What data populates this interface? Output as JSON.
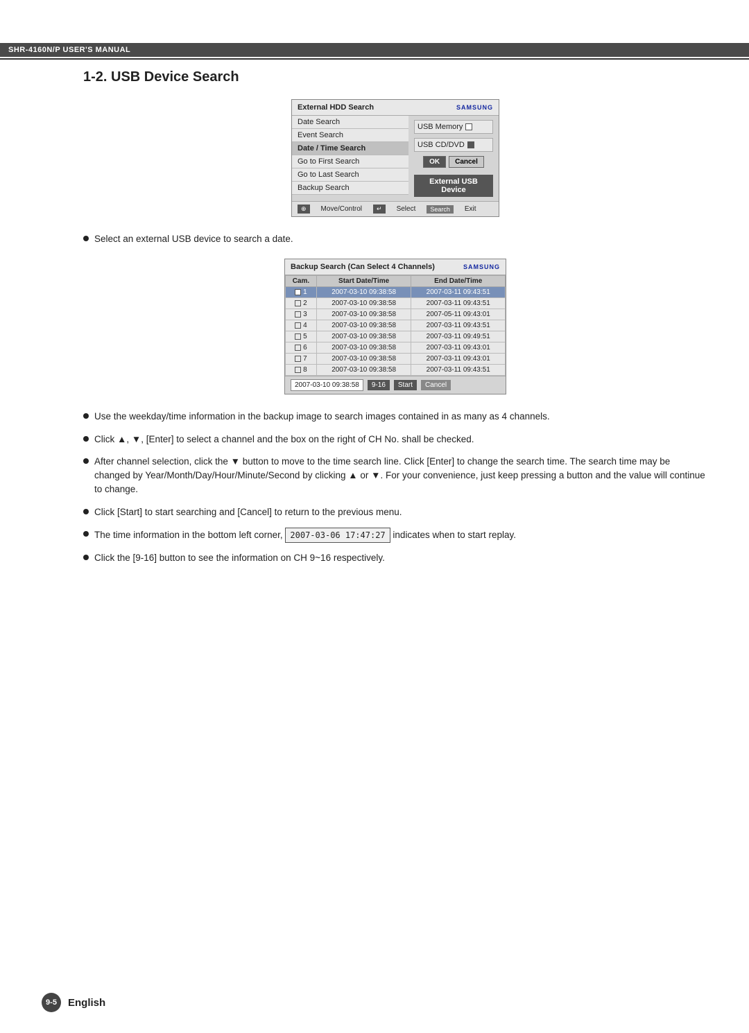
{
  "header": {
    "title": "SHR-4160N/P USER'S MANUAL"
  },
  "section": {
    "title": "1-2. USB Device Search"
  },
  "dialog1": {
    "title": "External HDD Search",
    "logo": "SAMSUNG",
    "menu_items": [
      {
        "label": "Date Search",
        "selected": false
      },
      {
        "label": "Event Search",
        "selected": false
      },
      {
        "label": "Date / Time Search",
        "selected": false
      },
      {
        "label": "Go to First Search",
        "selected": false
      },
      {
        "label": "Go to Last Search",
        "selected": false
      },
      {
        "label": "Backup Search",
        "selected": false
      }
    ],
    "right_panel": {
      "usb_memory_label": "USB Memory",
      "usb_cdvd_label": "USB CD/DVD",
      "ok_btn": "OK",
      "cancel_btn": "Cancel",
      "external_usb": "External USB Device"
    },
    "footer": {
      "move_control": "Move/Control",
      "select": "Select",
      "exit": "Exit"
    }
  },
  "bullet1": "Select an external USB device to search a date.",
  "dialog2": {
    "title": "Backup Search (Can Select 4 Channels)",
    "logo": "SAMSUNG",
    "table": {
      "headers": [
        "Cam.",
        "Start Date/Time",
        "End Date/Time"
      ],
      "rows": [
        {
          "cam": "1",
          "checked": true,
          "start": "2007-03-10  09:38:58",
          "end": "2007-03-11  09:43:51",
          "selected": true
        },
        {
          "cam": "2",
          "checked": false,
          "start": "2007-03-10  09:38:58",
          "end": "2007-03-11  09:43:51",
          "selected": false
        },
        {
          "cam": "3",
          "checked": false,
          "start": "2007-03-10  09:38:58",
          "end": "2007-05-11  09:43:01",
          "selected": false
        },
        {
          "cam": "4",
          "checked": false,
          "start": "2007-03-10  09:38:58",
          "end": "2007-03-11  09:43:51",
          "selected": false
        },
        {
          "cam": "5",
          "checked": false,
          "start": "2007-03-10  09:38:58",
          "end": "2007-03-11  09:49:51",
          "selected": false
        },
        {
          "cam": "6",
          "checked": false,
          "start": "2007-03-10  09:38:58",
          "end": "2007-03-11  09:43:01",
          "selected": false
        },
        {
          "cam": "7",
          "checked": false,
          "start": "2007-03-10  09:38:58",
          "end": "2007-03-11  09:43:01",
          "selected": false
        },
        {
          "cam": "8",
          "checked": false,
          "start": "2007-03-10  09:38:58",
          "end": "2007-03-11  09:43:51",
          "selected": false
        }
      ]
    },
    "footer": {
      "datetime": "2007-03-10  09:38:58",
      "range_btn": "9-16",
      "start_btn": "Start",
      "cancel_btn": "Cancel"
    }
  },
  "bullets": [
    {
      "text": "Use the weekday/time information in the backup image to search images contained in as many as 4 channels."
    },
    {
      "text": "Click ▲, ▼, [Enter] to select a channel and the box on the right of CH No. shall be checked."
    },
    {
      "text": "After channel selection, click the ▼ button to move to the time search line. Click [Enter] to change the search time. The search time may be changed by Year/Month/Day/Hour/Minute/Second by clicking ▲ or ▼. For your convenience, just keep pressing a button and the value will continue to change."
    },
    {
      "text": "Click [Start] to start searching and [Cancel] to return to the previous menu."
    },
    {
      "text_before": "The time information in the bottom left corner, ",
      "inline": "2007-03-06 17:47:27",
      "text_after": " indicates when to start replay."
    },
    {
      "text": "Click the [9-16] button to see the information on CH 9~16 respectively."
    }
  ],
  "footer": {
    "badge": "9-5",
    "language": "English"
  }
}
